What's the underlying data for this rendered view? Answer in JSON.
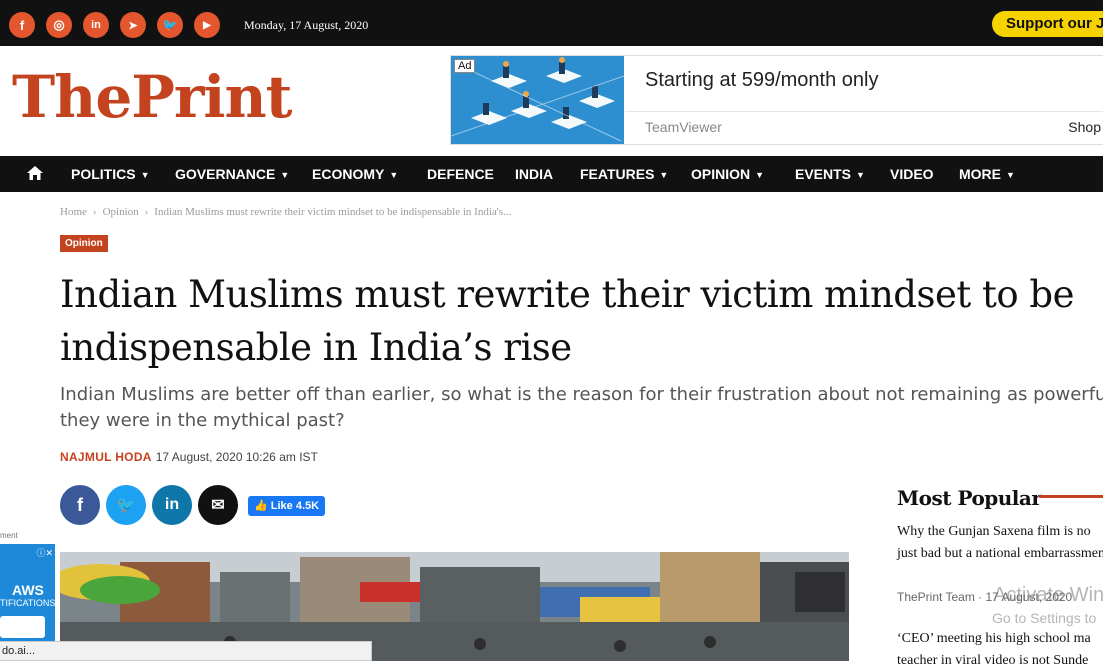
{
  "topbar": {
    "social": [
      {
        "icon": "facebook-icon",
        "glyph": "f"
      },
      {
        "icon": "instagram-icon",
        "glyph": "◎"
      },
      {
        "icon": "linkedin-icon",
        "glyph": "in"
      },
      {
        "icon": "telegram-icon",
        "glyph": "➤"
      },
      {
        "icon": "twitter-icon",
        "glyph": "🐦"
      },
      {
        "icon": "youtube-icon",
        "glyph": "▶"
      }
    ],
    "date": "Monday, 17 August, 2020",
    "support_label": "Support our Jo"
  },
  "header": {
    "logo_the": "The",
    "logo_print": "Print",
    "ad": {
      "tag": "Ad",
      "headline": "Starting at 599/month only",
      "sponsor": "TeamViewer",
      "cta": "Shop"
    }
  },
  "nav": {
    "home_icon": "home-icon",
    "items": [
      {
        "label": "POLITICS",
        "dropdown": true
      },
      {
        "label": "GOVERNANCE",
        "dropdown": true
      },
      {
        "label": "ECONOMY",
        "dropdown": true
      },
      {
        "label": "DEFENCE",
        "dropdown": false
      },
      {
        "label": "INDIA",
        "dropdown": false
      },
      {
        "label": "FEATURES",
        "dropdown": true
      },
      {
        "label": "OPINION",
        "dropdown": true
      },
      {
        "label": "EVENTS",
        "dropdown": true
      },
      {
        "label": "VIDEO",
        "dropdown": false
      },
      {
        "label": "MORE",
        "dropdown": true
      }
    ]
  },
  "article": {
    "breadcrumb": [
      "Home",
      "Opinion",
      "Indian Muslims must rewrite their victim mindset to be indispensable in India's..."
    ],
    "category": "Opinion",
    "title": "Indian Muslims must rewrite their victim mindset to be indispensable in India’s rise",
    "subtitle": "Indian Muslims are better off than earlier, so what is the reason for their frustration about not remaining as powerful a\nthey were in the mythical past?",
    "author": "NAJMUL HODA",
    "timestamp": "17 August, 2020 10:26 am IST",
    "share": [
      {
        "icon": "facebook-icon",
        "glyph": "f",
        "color": "#3b5998"
      },
      {
        "icon": "twitter-icon",
        "glyph": "🐦",
        "color": "#1da1f2"
      },
      {
        "icon": "linkedin-icon",
        "glyph": "in",
        "color": "#0e76a8"
      },
      {
        "icon": "email-icon",
        "glyph": "✉",
        "color": "#111111"
      }
    ],
    "fb_like": "Like 4.5K"
  },
  "left_ad": {
    "label": "ment",
    "brand": "AWS",
    "text": "TIFICATIONS"
  },
  "statusbar": "do.ai...",
  "sidebar": {
    "title": "Most Popular",
    "stories": [
      {
        "headline": "Why the Gunjan Saxena film is no just bad but a national embarrassment",
        "meta": "ThePrint Team · 17 August, 2020"
      },
      {
        "headline": "‘CEO’ meeting his high school ma teacher in viral video is not Sunde"
      }
    ]
  },
  "watermark": {
    "line1": "Activate Win",
    "line2": "Go to Settings to"
  },
  "colors": {
    "brand": "#c4431f",
    "dark": "#111111",
    "support": "#f6d300"
  }
}
